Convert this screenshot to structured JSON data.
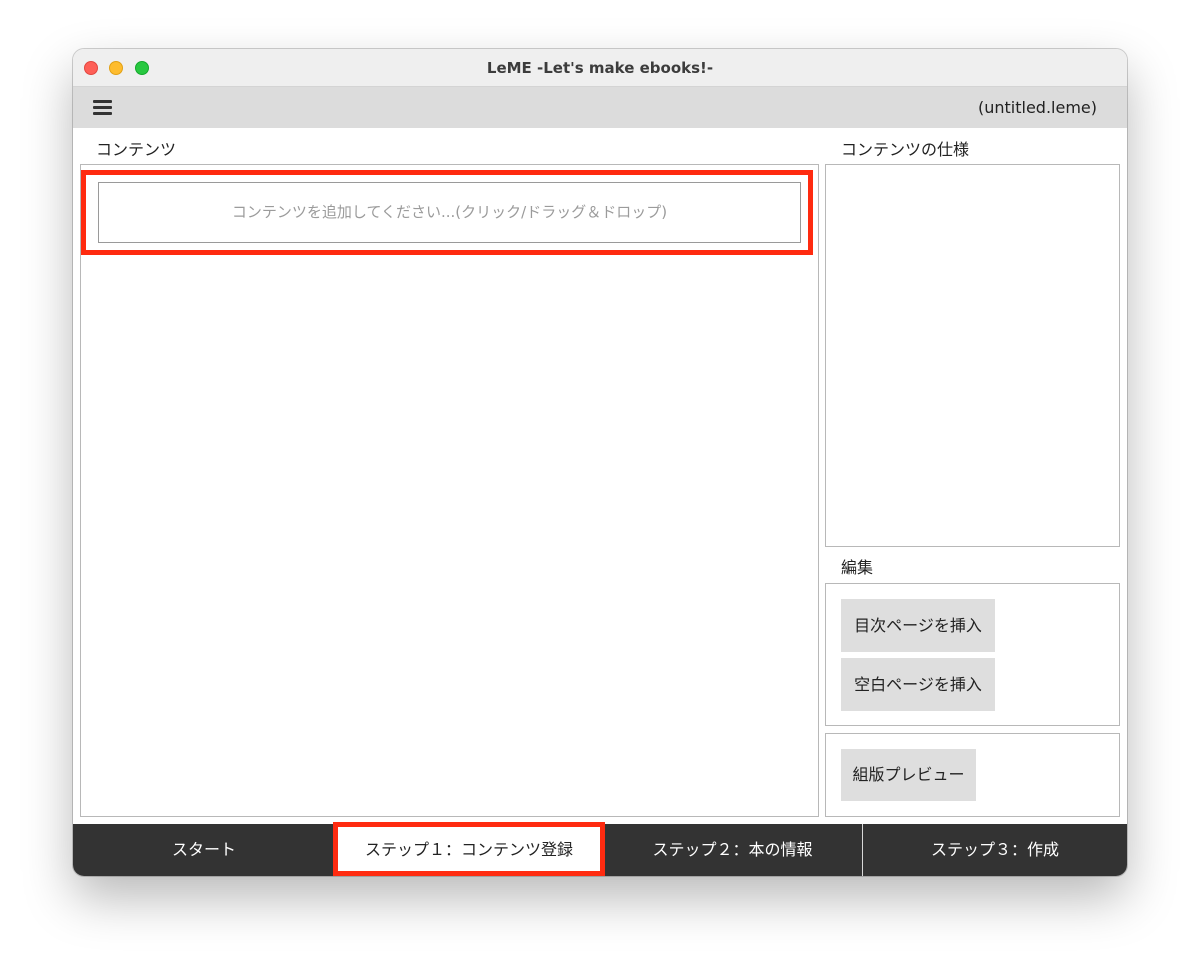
{
  "window": {
    "title": "LeME -Let's make ebooks!-"
  },
  "toolbar": {
    "menu_icon": "hamburger-menu-icon",
    "filename": "(untitled.leme)"
  },
  "contents": {
    "label": "コンテンツ",
    "add_placeholder": "コンテンツを追加してください...(クリック/ドラッグ＆ドロップ)"
  },
  "spec": {
    "label": "コンテンツの仕様"
  },
  "edit": {
    "label": "編集",
    "insert_toc_label": "目次ページを挿入",
    "insert_blank_label": "空白ページを挿入"
  },
  "preview": {
    "button_label": "組版プレビュー"
  },
  "steps": [
    {
      "label": "スタート",
      "active": false
    },
    {
      "label": "ステップ１：コンテンツ登録",
      "active": true
    },
    {
      "label": "ステップ２：本の情報",
      "active": false
    },
    {
      "label": "ステップ３：作成",
      "active": false
    }
  ],
  "colors": {
    "highlight": "#ff2b10",
    "bottom_bar": "#333333",
    "toolbar": "#dcdcdc",
    "button": "#dedede"
  }
}
